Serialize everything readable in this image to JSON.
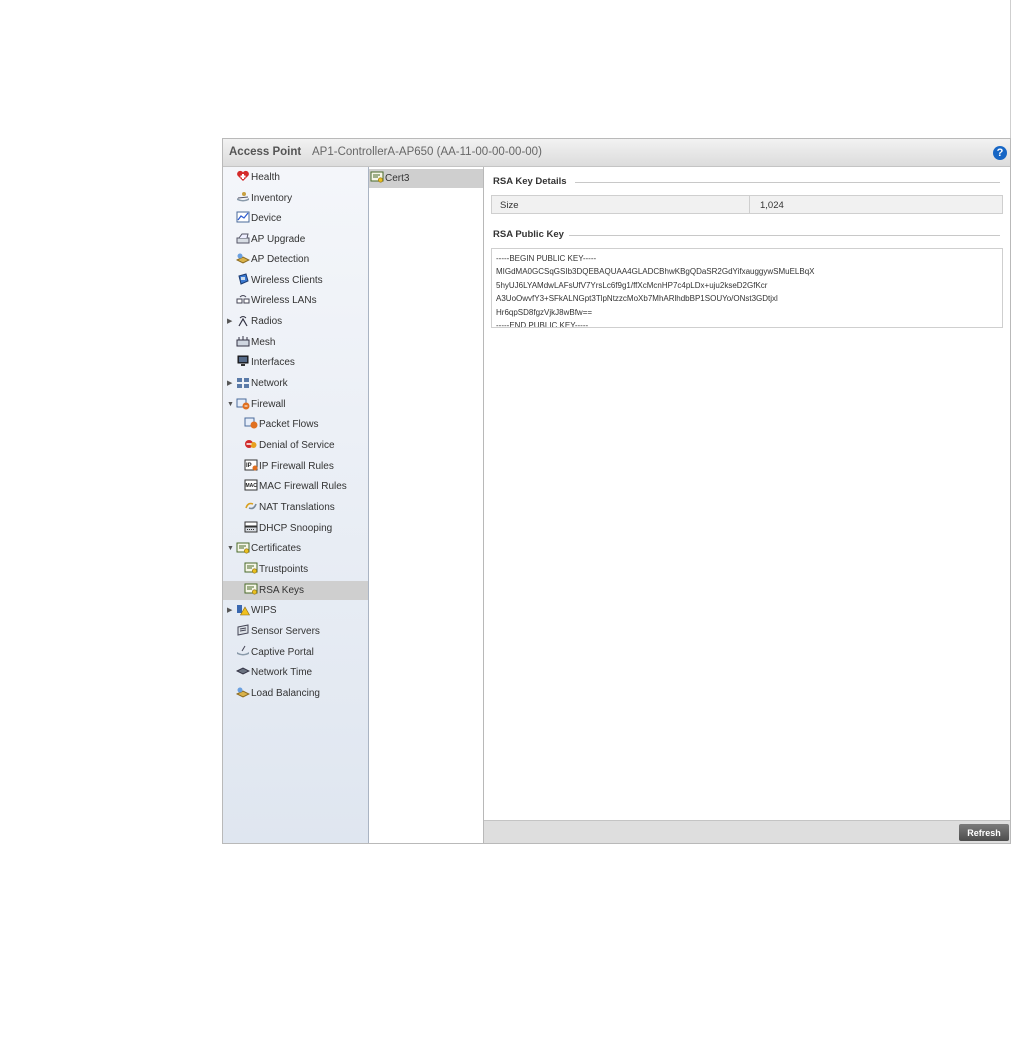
{
  "header": {
    "title": "Access Point",
    "subtitle": "AP1-ControllerA-AP650 (AA-11-00-00-00-00)",
    "help_icon": "help-icon"
  },
  "nav": {
    "health": "Health",
    "inventory": "Inventory",
    "device": "Device",
    "ap_upgrade": "AP Upgrade",
    "ap_detection": "AP Detection",
    "wireless_clients": "Wireless Clients",
    "wireless_lans": "Wireless LANs",
    "radios": "Radios",
    "mesh": "Mesh",
    "interfaces": "Interfaces",
    "network": "Network",
    "firewall": "Firewall",
    "packet_flows": "Packet Flows",
    "denial_of_service": "Denial of Service",
    "ip_firewall_rules": "IP Firewall Rules",
    "mac_firewall_rules": "MAC Firewall Rules",
    "nat_translations": "NAT Translations",
    "dhcp_snooping": "DHCP Snooping",
    "certificates": "Certificates",
    "trustpoints": "Trustpoints",
    "rsa_keys": "RSA Keys",
    "wips": "WIPS",
    "sensor_servers": "Sensor Servers",
    "captive_portal": "Captive Portal",
    "network_time": "Network Time",
    "load_balancing": "Load Balancing"
  },
  "certs": {
    "item": "Cert3"
  },
  "details": {
    "section_title": "RSA Key Details",
    "size_label": "Size",
    "size_value": "1,024",
    "public_key_title": "RSA Public Key",
    "public_key_text": "-----BEGIN PUBLIC KEY-----\nMIGdMA0GCSqGSIb3DQEBAQUAA4GLADCBhwKBgQDaSR2GdYifxauggywSMuELBqX\n5hyUJ6LYAMdwLAFsUfV7YrsLc6f9g1/ffXcMcnHP7c4pLDx+uju2kseD2GfKcr\nA3UoOwvfY3+SFkALNGpt3TlpNtzzcMoXb7MhARlhdbBP1SOUYo/ONst3GDtjxl\nHr6qpSD8fgzVjkJ8wBfw==\n-----END PUBLIC KEY-----"
  },
  "footer": {
    "refresh_label": "Refresh"
  },
  "colors": {
    "accent": "#1766c5",
    "sidebar_top": "#f4f6fa",
    "sidebar_bottom": "#dfe6f0",
    "selected": "#cfcfcf",
    "footer": "#dedede"
  }
}
